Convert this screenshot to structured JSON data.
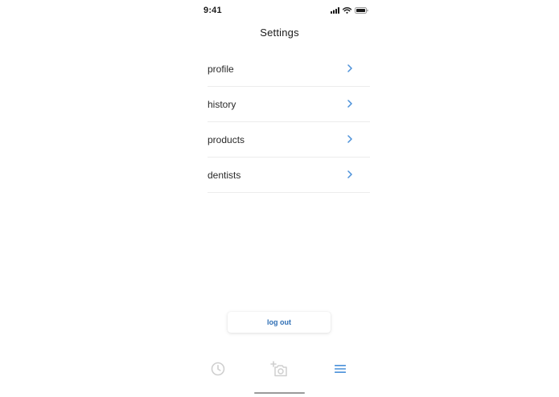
{
  "status_bar": {
    "time": "9:41",
    "icons": [
      "signal-icon",
      "wifi-icon",
      "battery-icon"
    ]
  },
  "header": {
    "title": "Settings"
  },
  "settings": {
    "items": [
      {
        "label": "profile",
        "icon": "chevron-right-icon"
      },
      {
        "label": "history",
        "icon": "chevron-right-icon"
      },
      {
        "label": "products",
        "icon": "chevron-right-icon"
      },
      {
        "label": "dentists",
        "icon": "chevron-right-icon"
      }
    ]
  },
  "actions": {
    "logout_label": "log out"
  },
  "tab_bar": {
    "tabs": [
      {
        "icon": "clock-icon",
        "active": false
      },
      {
        "icon": "add-photo-camera-icon",
        "active": false
      },
      {
        "icon": "menu-icon",
        "active": true
      }
    ]
  },
  "colors": {
    "accent": "#4a90d9",
    "logout_text": "#2f6fb5",
    "inactive_icon": "#cfcfcf",
    "divider": "#ececec",
    "text": "#2a2a2a"
  }
}
